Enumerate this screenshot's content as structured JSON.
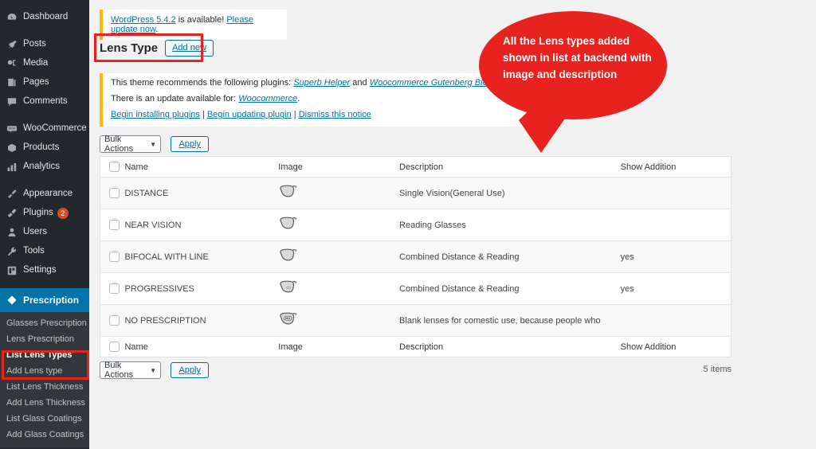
{
  "sidebar": {
    "items": [
      {
        "label": "Dashboard",
        "icon": "dashboard-icon",
        "gap_before": false
      },
      {
        "label": "Posts",
        "icon": "pin-icon",
        "gap_before": true
      },
      {
        "label": "Media",
        "icon": "media-icon",
        "gap_before": false
      },
      {
        "label": "Pages",
        "icon": "pages-icon",
        "gap_before": false
      },
      {
        "label": "Comments",
        "icon": "comment-icon",
        "gap_before": false
      },
      {
        "label": "WooCommerce",
        "icon": "woocommerce-icon",
        "gap_before": true
      },
      {
        "label": "Products",
        "icon": "products-icon",
        "gap_before": false
      },
      {
        "label": "Analytics",
        "icon": "analytics-icon",
        "gap_before": false
      },
      {
        "label": "Appearance",
        "icon": "brush-icon",
        "gap_before": true
      },
      {
        "label": "Plugins",
        "icon": "plugins-icon",
        "gap_before": false,
        "badge": "2"
      },
      {
        "label": "Users",
        "icon": "users-icon",
        "gap_before": false
      },
      {
        "label": "Tools",
        "icon": "tools-icon",
        "gap_before": false
      },
      {
        "label": "Settings",
        "icon": "settings-icon",
        "gap_before": false
      }
    ],
    "current": {
      "label": "Prescription",
      "icon": "prescription-icon"
    },
    "submenu": [
      {
        "label": "Glasses Prescription",
        "active": false
      },
      {
        "label": "Lens Prescription",
        "active": false
      },
      {
        "label": "List Lens Types",
        "active": true
      },
      {
        "label": "Add Lens type",
        "active": false
      },
      {
        "label": "List Lens Thickness",
        "active": false
      },
      {
        "label": "Add Lens Thickness",
        "active": false
      },
      {
        "label": "List Glass Coatings",
        "active": false
      },
      {
        "label": "Add Glass Coatings",
        "active": false
      }
    ],
    "colors": {
      "background": "#23282d",
      "submenu_background": "#32373c",
      "current_highlight": "#0073aa",
      "badge": "#d54e21"
    }
  },
  "notices": {
    "wordpress_update": {
      "link_version": "WordPress 5.4.2",
      "middle_text": " is available! ",
      "link_update": "Please update now",
      "trailing": "."
    },
    "plugins": {
      "line1_prefix": "This theme recommends the following plugins: ",
      "line1_link1": "Superb Helper",
      "line1_middle": " and ",
      "line1_link2": "Woocommerce Gutenberg Blocks",
      "line1_suffix": ".",
      "line2_prefix": "There is an update available for: ",
      "line2_link": "Woocommerce",
      "line2_suffix": ".",
      "action_install": "Begin installing plugins",
      "action_update": "Begin updating plugin",
      "action_dismiss": "Dismiss this notice",
      "separator": " | "
    },
    "accent_color": "#ffb900"
  },
  "page": {
    "title": "Lens Type",
    "add_new_label": "Add new"
  },
  "tablenav": {
    "bulk_actions_label": "Bulk Actions",
    "apply_label": "Apply",
    "items_count": "5 items"
  },
  "table": {
    "columns": [
      "Name",
      "Image",
      "Description",
      "Show Addition"
    ],
    "rows": [
      {
        "name": "DISTANCE",
        "image": "lens-icon",
        "image_text": "",
        "description": "Single Vision(General Use)",
        "show_addition": ""
      },
      {
        "name": "NEAR VISION",
        "image": "lens-icon",
        "image_text": "",
        "description": "Reading Glasses",
        "show_addition": ""
      },
      {
        "name": "BIFOCAL WITH LINE",
        "image": "lens-icon",
        "image_text": "",
        "description": "Combined Distance & Reading",
        "show_addition": "yes"
      },
      {
        "name": "PROGRESSIVES",
        "image": "lens-icon",
        "image_text": "",
        "description": "Combined Distance & Reading",
        "show_addition": "yes"
      },
      {
        "name": "NO PRESCRIPTION",
        "image": "lens-icon-no",
        "image_text": "NO",
        "description": "Blank lenses for comestic use, because people who",
        "show_addition": ""
      }
    ]
  },
  "callout": {
    "text": "All the Lens types added shown in list at backend with image and description",
    "color": "#e8231f"
  },
  "highlights": {
    "color": "#e8231f"
  }
}
